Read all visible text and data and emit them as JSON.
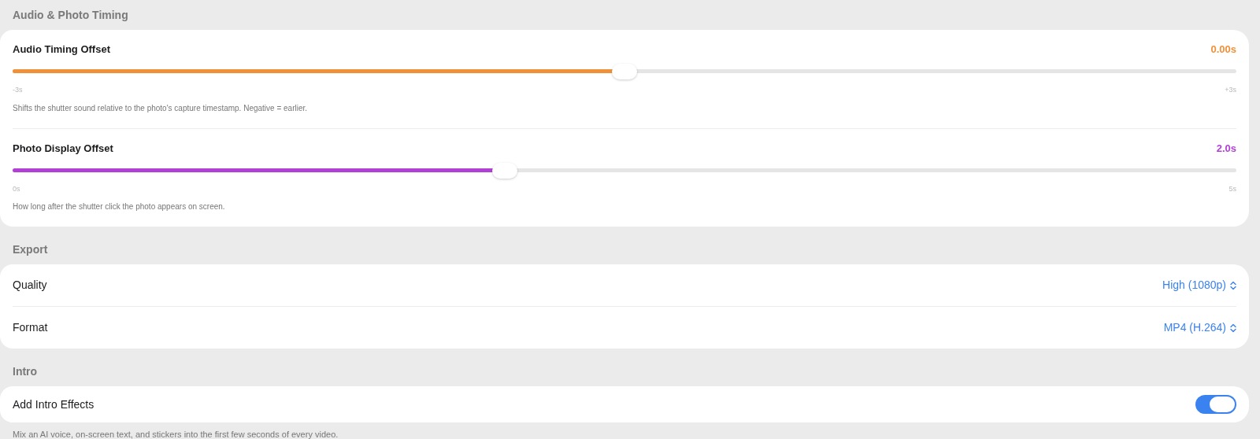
{
  "sections": [
    {
      "title": "Audio & Photo Timing",
      "kind": "sliders",
      "items": [
        {
          "label": "Audio Timing Offset",
          "value": "0.00s",
          "color": "#f0913a",
          "level": 0.5,
          "min_label": "-3s",
          "max_label": "+3s",
          "description": "Shifts the shutter sound relative to the photo's capture timestamp. Negative = earlier."
        },
        {
          "label": "Photo Display Offset",
          "value": "2.0s",
          "color": "#b23fd6",
          "level": 0.4,
          "min_label": "0s",
          "max_label": "5s",
          "description": "How long after the shutter click the photo appears on screen."
        }
      ]
    },
    {
      "title": "Export",
      "kind": "pickers",
      "items": [
        {
          "label": "Quality",
          "value": "High (1080p)"
        },
        {
          "label": "Format",
          "value": "MP4 (H.264)"
        }
      ]
    },
    {
      "title": "Intro",
      "kind": "toggles",
      "items": [
        {
          "label": "Add Intro Effects",
          "on": true
        }
      ],
      "footnote": "Mix an AI voice, on-screen text, and stickers into the first few seconds of every video."
    }
  ]
}
